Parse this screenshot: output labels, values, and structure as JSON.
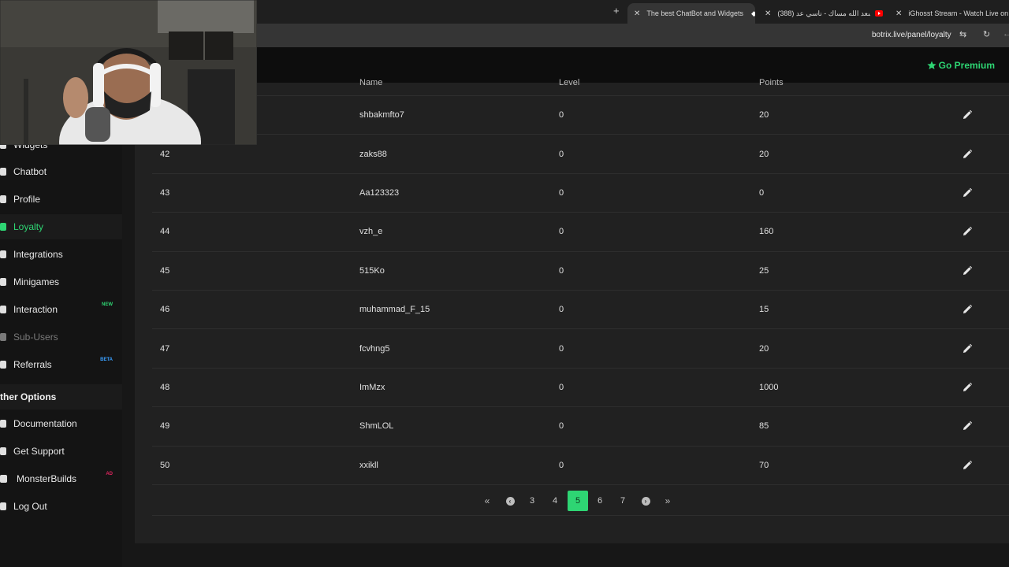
{
  "browser": {
    "tabs": [
      {
        "title": "The best ChatBot and Widgets",
        "active": true
      },
      {
        "title": "(388) أسعد الله مساك - ناسي عد",
        "active": false
      },
      {
        "title": "iGhosst Stream - Watch Live on",
        "active": false
      }
    ],
    "url": "botrix.live/panel/loyalty"
  },
  "header": {
    "premium_label": "Go Premium"
  },
  "sidebar": {
    "items": [
      {
        "label": "Widgets",
        "state": "normal",
        "icon": "widget-icon"
      },
      {
        "label": "Chatbot",
        "state": "normal",
        "icon": "robot-icon"
      },
      {
        "label": "Profile",
        "state": "normal",
        "icon": "id-card-icon"
      },
      {
        "label": "Loyalty",
        "state": "active",
        "icon": "trophy-icon"
      },
      {
        "label": "Integrations",
        "state": "normal",
        "icon": "plug-icon"
      },
      {
        "label": "Minigames",
        "state": "normal",
        "icon": "gamepad-icon"
      },
      {
        "label": "Interaction",
        "state": "normal",
        "icon": "music-icon",
        "badge": "NEW"
      },
      {
        "label": "Sub-Users",
        "state": "dim",
        "icon": "users-icon"
      },
      {
        "label": "Referrals",
        "state": "normal",
        "icon": "people-icon",
        "badge": "BETA"
      }
    ],
    "other_section_title": "ther Options",
    "other_items": [
      {
        "label": "Documentation",
        "icon": "book-icon"
      },
      {
        "label": "Get Support",
        "icon": "question-icon"
      },
      {
        "label": "MonsterBuilds",
        "icon": "laptop-icon",
        "badge": "AD"
      },
      {
        "label": "Log Out",
        "icon": "logout-icon"
      }
    ],
    "badge_colors": {
      "NEW": "#2ed573",
      "BETA": "#3aa0ff",
      "AD": "#e0245e"
    }
  },
  "table": {
    "columns": [
      "Name",
      "Level",
      "Points"
    ],
    "rows": [
      {
        "id": "",
        "name": "shbakmfto7",
        "level": "0",
        "points": "20"
      },
      {
        "id": "42",
        "name": "zaks88",
        "level": "0",
        "points": "20"
      },
      {
        "id": "43",
        "name": "Aa123323",
        "level": "0",
        "points": "0"
      },
      {
        "id": "44",
        "name": "vzh_e",
        "level": "0",
        "points": "160"
      },
      {
        "id": "45",
        "name": "515Ko",
        "level": "0",
        "points": "25"
      },
      {
        "id": "46",
        "name": "muhammad_F_15",
        "level": "0",
        "points": "15"
      },
      {
        "id": "47",
        "name": "fcvhng5",
        "level": "0",
        "points": "20"
      },
      {
        "id": "48",
        "name": "ImMzx",
        "level": "0",
        "points": "1000"
      },
      {
        "id": "49",
        "name": "ShmLOL",
        "level": "0",
        "points": "85"
      },
      {
        "id": "50",
        "name": "xxikll",
        "level": "0",
        "points": "70"
      }
    ]
  },
  "pagination": {
    "pages": [
      "3",
      "4",
      "5",
      "6",
      "7"
    ],
    "current": "5"
  },
  "colors": {
    "accent": "#2ed573",
    "background": "#171717",
    "panel": "#212121"
  }
}
